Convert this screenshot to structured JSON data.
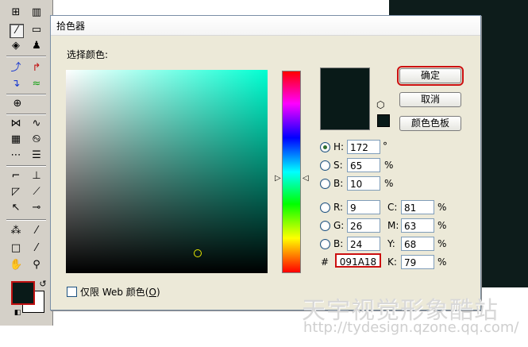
{
  "dialog": {
    "title": "拾色器",
    "section_label": "选择颜色:",
    "buttons": {
      "ok": "确定",
      "cancel": "取消",
      "swatches": "颜色色板"
    },
    "current_color": "#091a18",
    "hsb": {
      "h": {
        "label": "H:",
        "value": "172",
        "unit": "°"
      },
      "s": {
        "label": "S:",
        "value": "65",
        "unit": "%"
      },
      "b": {
        "label": "B:",
        "value": "10",
        "unit": "%"
      }
    },
    "rgb": {
      "r": {
        "label": "R:",
        "value": "9"
      },
      "g": {
        "label": "G:",
        "value": "26"
      },
      "b": {
        "label": "B:",
        "value": "24"
      }
    },
    "cmyk": {
      "c": {
        "label": "C:",
        "value": "81",
        "unit": "%"
      },
      "m": {
        "label": "M:",
        "value": "63",
        "unit": "%"
      },
      "y": {
        "label": "Y:",
        "value": "68",
        "unit": "%"
      },
      "k": {
        "label": "K:",
        "value": "79",
        "unit": "%"
      }
    },
    "hex": {
      "label": "#",
      "value": "091A18"
    },
    "web_only": {
      "label": "仅限 Web 颜色(",
      "underlined": "O",
      "label_end": ")",
      "checked": false
    },
    "selected_radio": "H"
  },
  "watermark": {
    "text": "天宇视觉形象酷站",
    "url": "http://tydesign.qzone.qq.com/"
  },
  "toolbox": {
    "foreground_color": "#091a18",
    "background_color": "#ffffff"
  }
}
